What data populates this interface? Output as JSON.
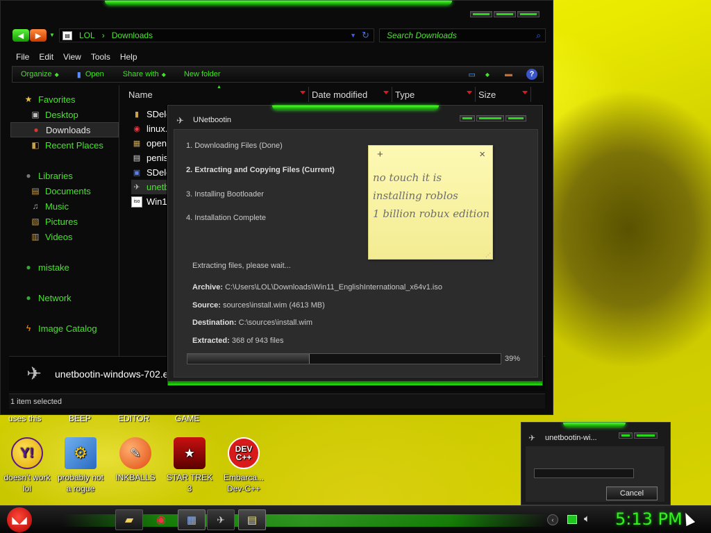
{
  "explorer": {
    "breadcrumb": [
      "LOL",
      "Downloads"
    ],
    "search_placeholder": "Search Downloads",
    "menu": [
      "File",
      "Edit",
      "View",
      "Tools",
      "Help"
    ],
    "commands": {
      "organize": "Organize",
      "open": "Open",
      "share": "Share with",
      "new_folder": "New folder"
    },
    "nav": {
      "favorites": "Favorites",
      "desktop": "Desktop",
      "downloads": "Downloads",
      "recent": "Recent Places",
      "libraries": "Libraries",
      "documents": "Documents",
      "music": "Music",
      "pictures": "Pictures",
      "videos": "Videos",
      "mistake": "mistake",
      "network": "Network",
      "image_catalog": "Image Catalog"
    },
    "columns": {
      "name": "Name",
      "date": "Date modified",
      "type": "Type",
      "size": "Size"
    },
    "files": [
      "SDele",
      "linux.",
      "openg",
      "penis",
      "SDele",
      "unetb",
      "Win1"
    ],
    "details_name": "unetbootin-windows-702.e",
    "status": "1 item selected"
  },
  "unetbootin": {
    "title": "UNetbootin",
    "steps": [
      "1. Downloading Files (Done)",
      "2. Extracting and Copying Files (Current)",
      "3. Installing Bootloader",
      "4. Installation Complete"
    ],
    "wait_text": "Extracting files, please wait...",
    "archive_label": "Archive:",
    "archive_value": "C:\\Users\\LOL\\Downloads\\Win11_EnglishInternational_x64v1.iso",
    "source_label": "Source:",
    "source_value": "sources\\install.wim (4613 MB)",
    "destination_label": "Destination:",
    "destination_value": "C:\\sources\\install.wim",
    "extracted_label": "Extracted:",
    "extracted_value": "368 of 943 files",
    "progress": 39,
    "progress_text": "39%"
  },
  "sticky": {
    "plus": "+",
    "close": "×",
    "lines": [
      "no touch it is",
      "installing roblos",
      "1 billion robux edition"
    ]
  },
  "desktop": {
    "top_labels": [
      "uses this",
      "BEEP",
      "EDITOR",
      "GAME"
    ],
    "icons": [
      {
        "label1": "doesn't work",
        "label2": "lol"
      },
      {
        "label1": "probably not",
        "label2": "a rogue"
      },
      {
        "label1": "INKBALLS",
        "label2": ""
      },
      {
        "label1": "STAR TREK",
        "label2": "3"
      },
      {
        "label1": "Embarca...",
        "label2": "Dev-C++"
      }
    ],
    "devcpp_text": "DEV\nC++"
  },
  "mini_dialog": {
    "title": "unetbootin-wi...",
    "cancel": "Cancel"
  },
  "taskbar": {
    "clock": "5:13 PM"
  },
  "colors": {
    "accent": "#45e22a",
    "window_bg": "#0b0b0b",
    "progress": "#2b2b2b"
  }
}
